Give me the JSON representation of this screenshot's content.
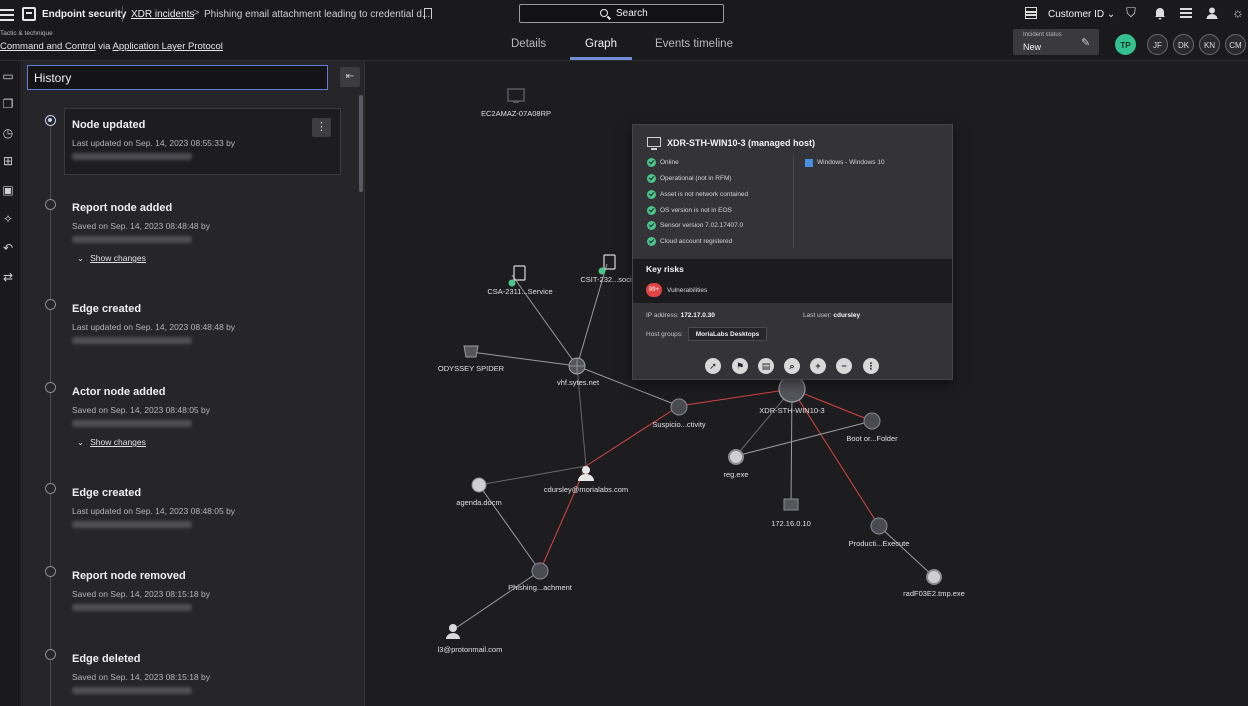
{
  "header": {
    "app_name": "Endpoint security",
    "breadcrumb_link": "XDR incidents",
    "breadcrumb_arrow": ">",
    "incident_title": "Phishing email attachment leading to credential d...",
    "tactic_label": "Tactic & technique",
    "tactic": "Command and Control",
    "tactic_via": "via",
    "technique": "Application Layer Protocol",
    "search_label": "Search",
    "customer_label": "Customer ID",
    "customer_chevron": "⌄",
    "incident_status_label": "Incident status",
    "incident_status_value": "New",
    "avatars": [
      "TP",
      "JF",
      "DK",
      "KN",
      "CM"
    ],
    "icons": [
      "grid-icon",
      "shield-icon",
      "bell-icon",
      "sliders-icon",
      "user-icon",
      "gear-icon"
    ]
  },
  "tabs": [
    {
      "label": "Details",
      "active": false
    },
    {
      "label": "Graph",
      "active": true
    },
    {
      "label": "Events timeline",
      "active": false
    }
  ],
  "history": {
    "search_value": "History",
    "entries": [
      {
        "title": "Node updated",
        "meta": "Last updated on Sep. 14, 2023 08:55:33 by",
        "active": true,
        "show_changes": false
      },
      {
        "title": "Report node added",
        "meta": "Saved on Sep. 14, 2023 08:48:48 by",
        "active": false,
        "show_changes": true
      },
      {
        "title": "Edge created",
        "meta": "Last updated on Sep. 14, 2023 08:48:48 by",
        "active": false,
        "show_changes": false
      },
      {
        "title": "Actor node added",
        "meta": "Saved on Sep. 14, 2023 08:48:05 by",
        "active": false,
        "show_changes": true
      },
      {
        "title": "Edge created",
        "meta": "Last updated on Sep. 14, 2023 08:48:05 by",
        "active": false,
        "show_changes": false
      },
      {
        "title": "Report node removed",
        "meta": "Saved on Sep. 14, 2023 08:15:18 by",
        "active": false,
        "show_changes": false
      },
      {
        "title": "Edge deleted",
        "meta": "Saved on Sep. 14, 2023 08:15:18 by",
        "active": false,
        "show_changes": false
      }
    ],
    "show_changes_label": "Show changes"
  },
  "graph": {
    "nodes": {
      "ec2": "EC2AMAZ-07A08RP",
      "csa": "CSA-2311...Service",
      "csit": "CSIT-232...soci",
      "odyssey": "ODYSSEY SPIDER",
      "vhf": "vhf.sytes.net",
      "suspicious": "Suspicio...ctivity",
      "xdr_host": "XDR-STH-WIN10-3",
      "boot": "Boot or...Folder",
      "reg": "reg.exe",
      "user": "cdursley@morialabs.com",
      "agenda": "agenda.docm",
      "ip": "172.16.0.10",
      "producti": "Producti...Execute",
      "phishing": "Phishing...achment",
      "radf": "radF03E2.tmp.exe",
      "proton": "l3@protonmail.com"
    }
  },
  "popup": {
    "title": "XDR-STH-WIN10-3 (managed host)",
    "checks": [
      "Online",
      "Operational (not in RFM)",
      "Asset is not network contained",
      "OS version is not in EOS",
      "Sensor version 7.02.17407.0",
      "Cloud account registered"
    ],
    "os": "Windows - Windows 10",
    "key_risks_label": "Key risks",
    "risk_badge": "99+",
    "risk_label": "Vulnerabilities",
    "ip_label": "IP address:",
    "ip_value": "172.17.0.30",
    "last_user_label": "Last user:",
    "last_user_value": "cdursley",
    "host_groups_label": "Host groups:",
    "host_group": "MoriaLabs Desktops",
    "actions": [
      "pointer-icon",
      "flag-icon",
      "comment-icon",
      "search-icon",
      "plus-icon",
      "minus-icon",
      "more-icon"
    ]
  }
}
